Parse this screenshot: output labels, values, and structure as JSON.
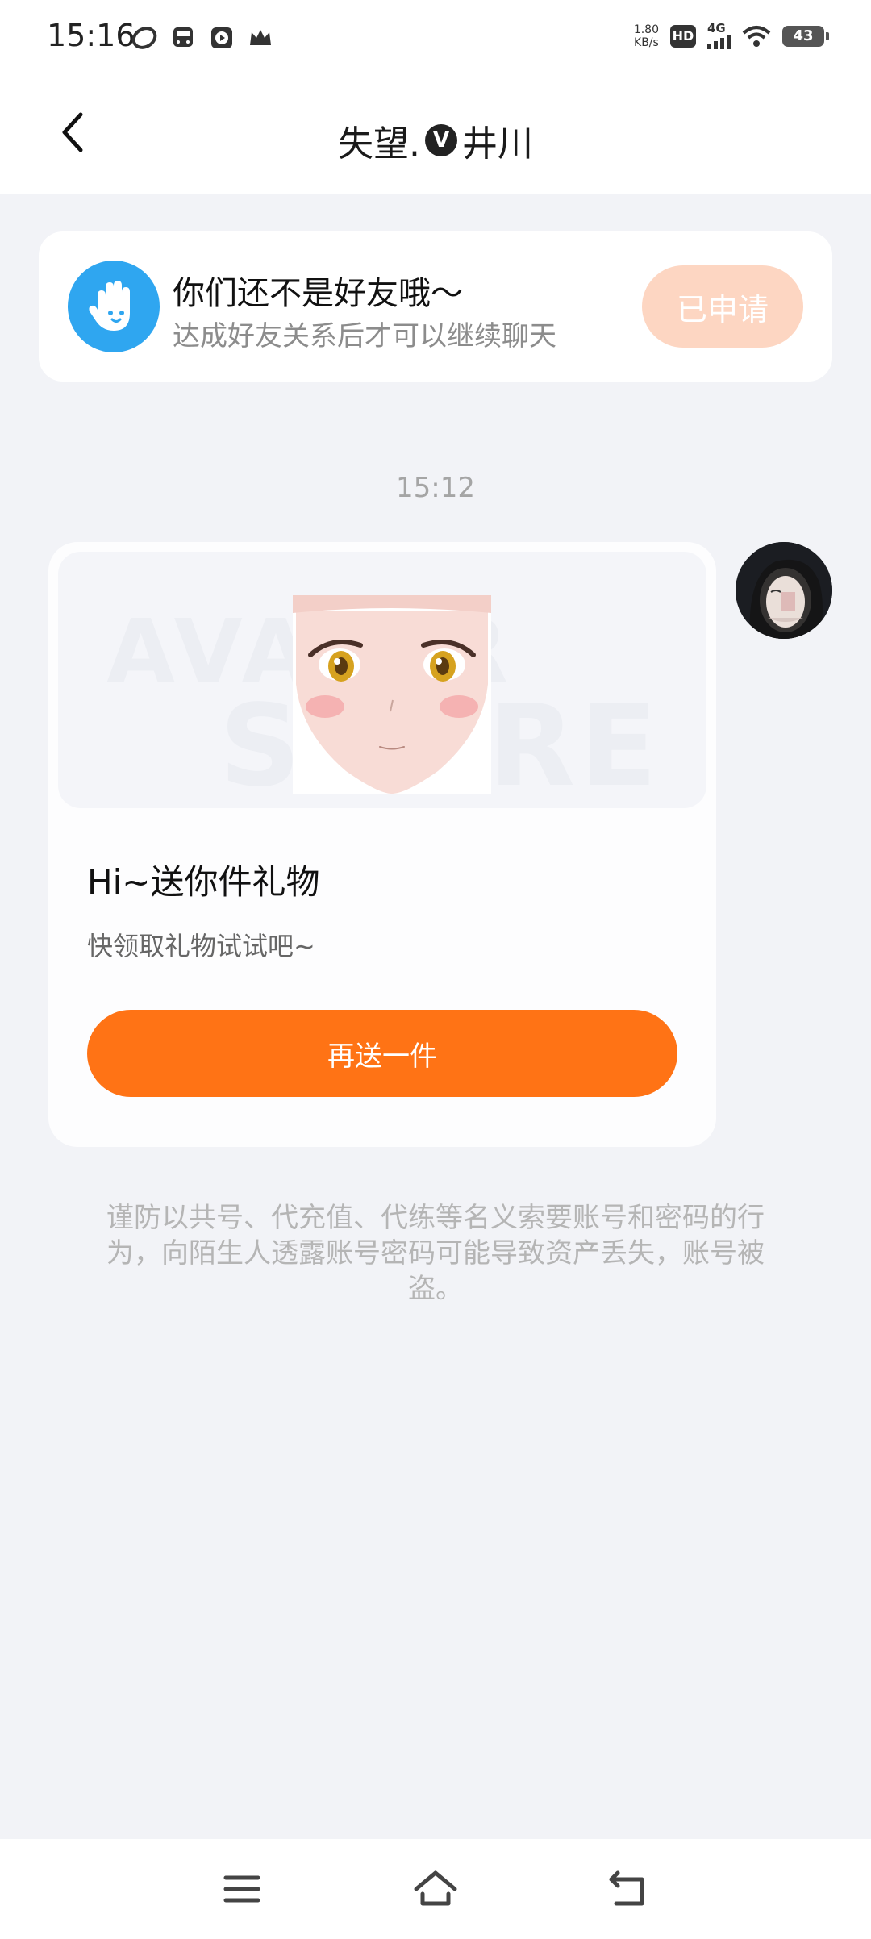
{
  "status_bar": {
    "time": "15:16",
    "net_speed_value": "1.80",
    "net_speed_unit": "KB/s",
    "hd": "HD",
    "network": "4G",
    "battery": "43"
  },
  "header": {
    "title_left": "失望.",
    "verified_badge": "V",
    "title_right": "井川",
    "back_icon": "chevron-left-icon"
  },
  "friend_notice": {
    "title": "你们还不是好友哦～",
    "subtitle": "达成好友关系后才可以继续聊天",
    "button": "已申请",
    "icon": "hand-icon"
  },
  "chat": {
    "timestamp": "15:12",
    "gift_card": {
      "watermark_line1": "AVATAR",
      "watermark_line2": "STORE",
      "title": "Hi~送你件礼物",
      "subtitle": "快领取礼物试试吧~",
      "button": "再送一件"
    }
  },
  "warning_text": "谨防以共号、代充值、代练等名义索要账号和密码的行为，向陌生人透露账号密码可能导致资产丢失，账号被盗。",
  "colors": {
    "accent": "#ff7315",
    "applied_button": "#fdd6c2",
    "icon_blue": "#2fa6f0",
    "background": "#f2f3f7"
  }
}
